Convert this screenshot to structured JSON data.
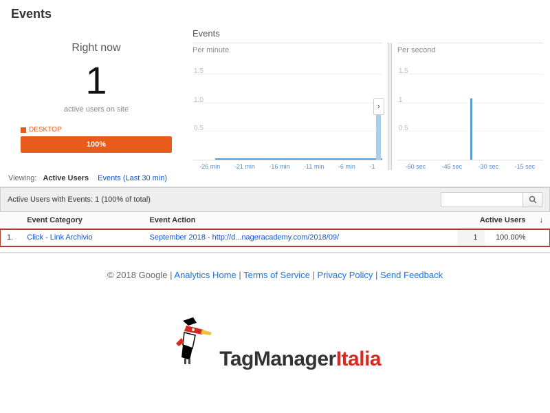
{
  "page_title": "Events",
  "rightnow": {
    "title": "Right now",
    "value": "1",
    "subtitle": "active users on site",
    "device_label": "DESKTOP",
    "device_pct": "100%"
  },
  "charts_title": "Events",
  "chart_data": [
    {
      "type": "bar",
      "label": "Per minute",
      "ylabels": [
        "1.5",
        "1.0",
        "0.5"
      ],
      "xticks": [
        "-26 min",
        "-21 min",
        "-16 min",
        "-11 min",
        "-6 min",
        "-1"
      ],
      "values_at_minus1": 1
    },
    {
      "type": "bar",
      "label": "Per second",
      "ylabels": [
        "1.5",
        "1",
        "0.5"
      ],
      "xticks": [
        "-60 sec",
        "-45 sec",
        "-30 sec",
        "-15 sec"
      ],
      "spike_at": "-30 sec",
      "spike_value": 1
    }
  ],
  "viewing": {
    "label": "Viewing:",
    "active": "Active Users",
    "other": "Events (Last 30 min)"
  },
  "summary": "Active Users with Events: 1 (100% of total)",
  "table": {
    "cols": [
      "Event Category",
      "Event Action",
      "Active Users"
    ],
    "rows": [
      {
        "idx": "1.",
        "category": "Click - Link Archivio",
        "action": "September 2018 - http://d...nageracademy.com/2018/09/",
        "users": "1",
        "pct": "100.00%"
      }
    ]
  },
  "footer": {
    "copyright": "© 2018 Google",
    "links": [
      "Analytics Home",
      "Terms of Service",
      "Privacy Policy",
      "Send Feedback"
    ]
  },
  "logo": {
    "a": "TagManager",
    "b": "Italia"
  }
}
